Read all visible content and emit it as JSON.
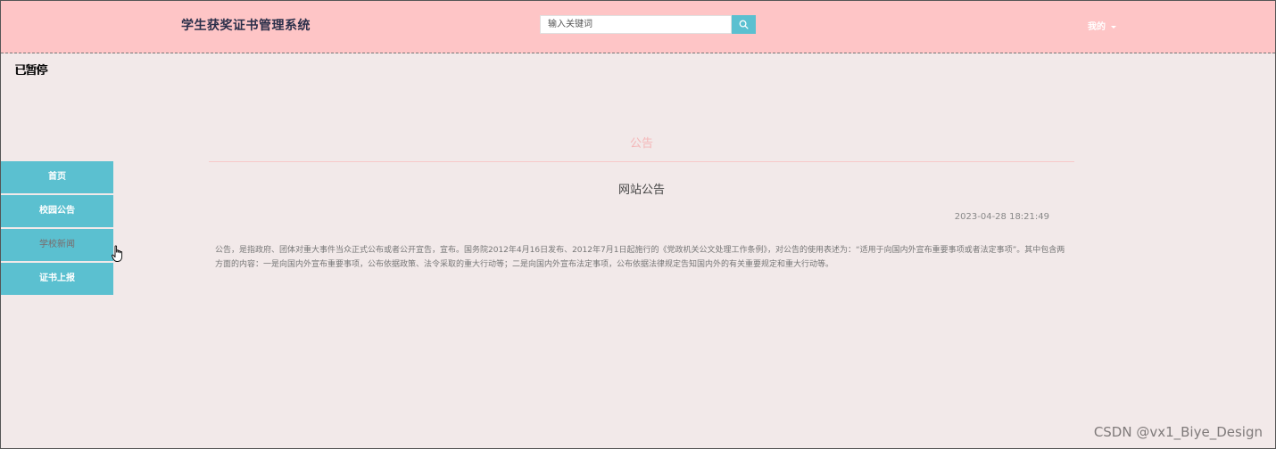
{
  "header": {
    "title": "学生获奖证书管理系统",
    "search_placeholder": "输入关键词",
    "user_label": "我的"
  },
  "overlay": {
    "paused_text": "已暂停"
  },
  "sidebar": {
    "items": [
      {
        "label": "首页"
      },
      {
        "label": "校园公告"
      },
      {
        "label": "学校新闻"
      },
      {
        "label": "证书上报"
      }
    ]
  },
  "main": {
    "section_title": "公告",
    "article_title": "网站公告",
    "article_date": "2023-04-28 18:21:49",
    "article_body": "公告，是指政府、团体对重大事件当众正式公布或者公开宣告，宣布。国务院2012年4月16日发布、2012年7月1日起施行的《党政机关公文处理工作条例》，对公告的使用表述为：“适用于向国内外宣布重要事项或者法定事项”。其中包含两方面的内容：一是向国内外宣布重要事项，公布依据政策、法令采取的重大行动等；二是向国内外宣布法定事项，公布依据法律规定告知国内外的有关重要规定和重大行动等。"
  },
  "watermark": "CSDN @vx1_Biye_Design",
  "colors": {
    "header_bg": "#fec5c6",
    "page_bg": "#f2e9e9",
    "accent": "#5bc0d0",
    "section_title": "#f4b7b8"
  },
  "icons": {
    "search": "search-icon",
    "dropdown": "caret-down-icon",
    "cursor": "hand-pointer-icon"
  }
}
